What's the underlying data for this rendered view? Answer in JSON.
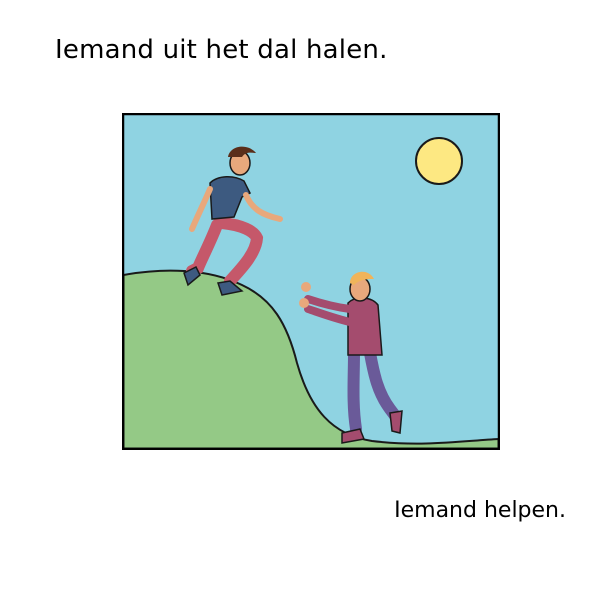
{
  "header": {
    "title": "Iemand uit het dal halen."
  },
  "illustration": {
    "colors": {
      "sky": "#8fd3e2",
      "hill": "#94c986",
      "sun": "#fde882",
      "outline": "#1a1a1a",
      "shirt_left": "#3d5a80",
      "pants_left": "#c5586a",
      "shirt_right": "#a44c6e",
      "pants_right": "#6a5a99",
      "skin": "#e8a87c",
      "hair_left": "#5a2e1a",
      "hair_right": "#f0b45a"
    }
  },
  "footer": {
    "caption": "Iemand helpen."
  }
}
